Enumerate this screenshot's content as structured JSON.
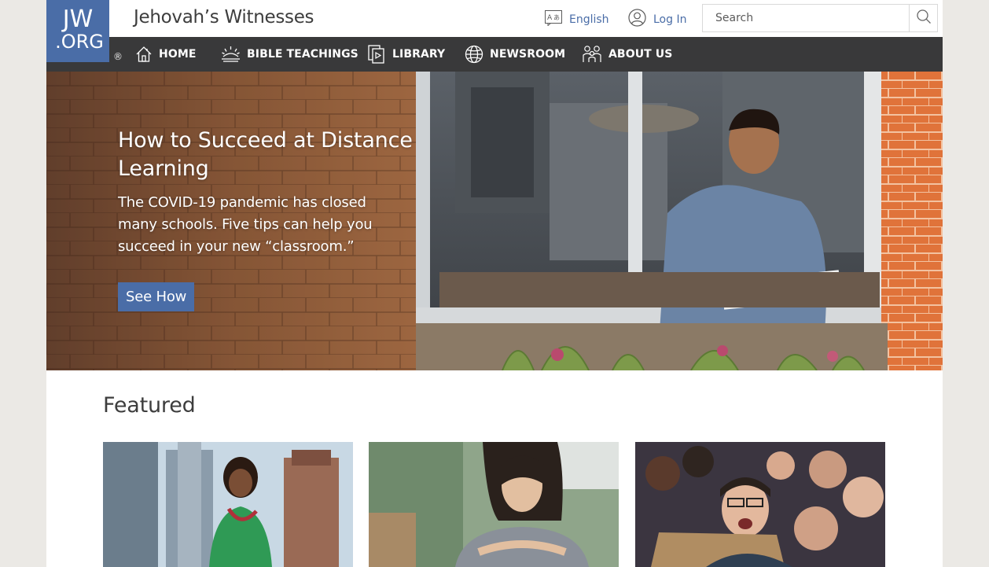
{
  "header": {
    "logo_line1": "JW",
    "logo_line2": ".ORG",
    "registered_mark": "®",
    "site_title": "Jehovah’s Witnesses",
    "language_label": "English",
    "login_label": "Log In",
    "search_placeholder": "Search"
  },
  "nav": {
    "items": [
      {
        "label": "HOME",
        "icon": "home-icon"
      },
      {
        "label": "BIBLE TEACHINGS",
        "icon": "sunrise-icon"
      },
      {
        "label": "LIBRARY",
        "icon": "library-icon"
      },
      {
        "label": "NEWSROOM",
        "icon": "globe-icon"
      },
      {
        "label": "ABOUT US",
        "icon": "people-icon"
      }
    ]
  },
  "hero": {
    "title": "How to Succeed at Distance Learning",
    "text": "The COVID-19 pandemic has closed many schools. Five tips can help you succeed in your new “classroom.”",
    "button_label": "See How"
  },
  "featured": {
    "heading": "Featured"
  },
  "colors": {
    "brand_blue": "#4a6da7",
    "nav_bg": "#39393a",
    "page_bg": "#ebe9e5"
  }
}
